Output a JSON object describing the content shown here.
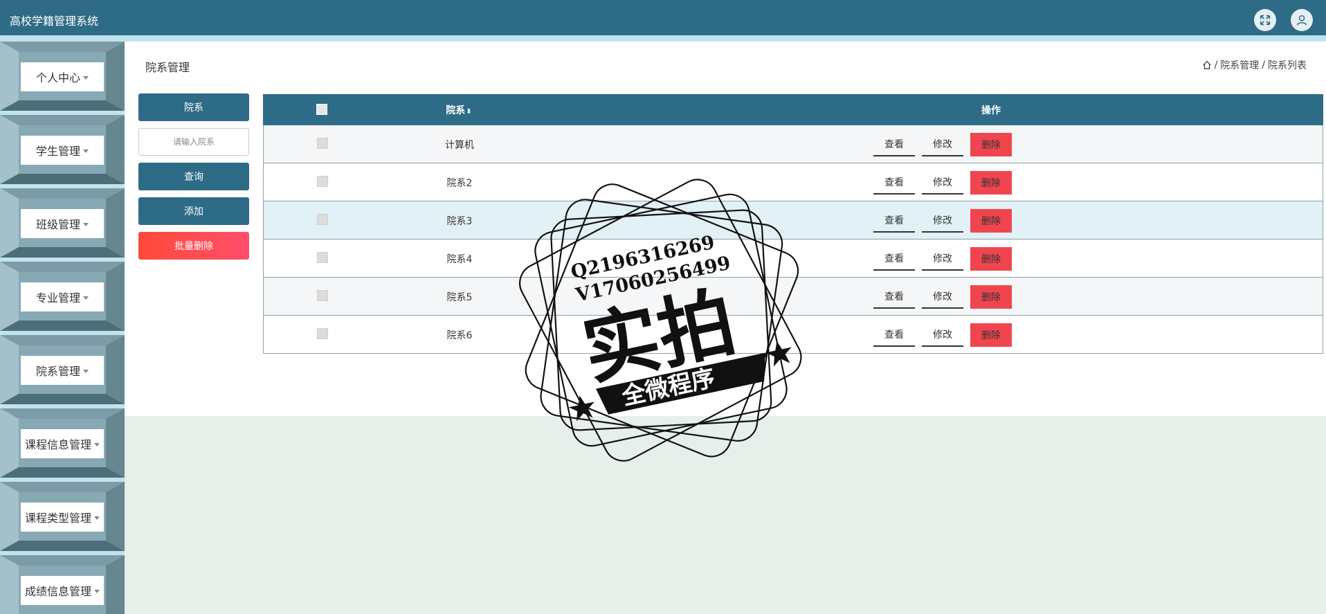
{
  "header": {
    "app_title": "高校学籍管理系统",
    "fullscreen_icon": "expand-icon",
    "user_icon": "user-icon"
  },
  "sidebar": {
    "items": [
      {
        "label": "个人中心"
      },
      {
        "label": "学生管理"
      },
      {
        "label": "班级管理"
      },
      {
        "label": "专业管理"
      },
      {
        "label": "院系管理"
      },
      {
        "label": "课程信息管理"
      },
      {
        "label": "课程类型管理"
      },
      {
        "label": "成绩信息管理"
      }
    ]
  },
  "page": {
    "title": "院系管理",
    "breadcrumb": {
      "home_icon": "home-icon",
      "sep1": "/",
      "level1": "院系管理",
      "sep2": "/",
      "level2": "院系列表"
    }
  },
  "search": {
    "field_label": "院系",
    "placeholder": "请输入院系",
    "value": "",
    "query_button": "查询",
    "add_button": "添加",
    "batch_delete_button": "批量删除"
  },
  "table": {
    "headers": {
      "name": "院系",
      "sort_glyph": "⬍",
      "ops": "操作"
    },
    "rows": [
      {
        "name": "计算机"
      },
      {
        "name": "院系2"
      },
      {
        "name": "院系3"
      },
      {
        "name": "院系4"
      },
      {
        "name": "院系5"
      },
      {
        "name": "院系6"
      }
    ],
    "row_actions": {
      "view": "查看",
      "edit": "修改",
      "delete": "删除"
    }
  },
  "watermark": {
    "line1": "Q2196316269",
    "line2": "V17060256499",
    "main": "实拍",
    "banner": "全微程序"
  },
  "colors": {
    "primary": "#2e6b86",
    "danger": "#f0454f",
    "sidebar_bg": "#bfe4ee",
    "content_bg": "#e6efea"
  }
}
